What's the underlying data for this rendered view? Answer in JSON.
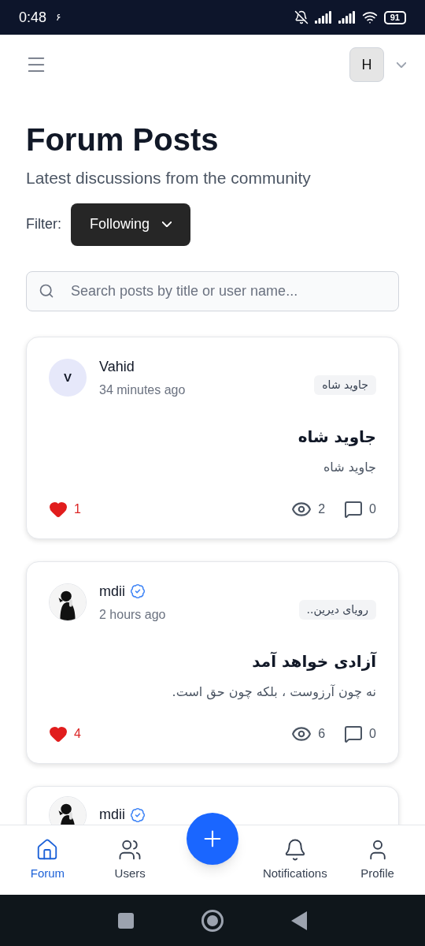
{
  "status_bar": {
    "time": "0:48",
    "indicator": "۶",
    "battery": "91"
  },
  "header": {
    "account_initial": "H"
  },
  "page": {
    "title": "Forum Posts",
    "subtitle": "Latest discussions from the community"
  },
  "filter": {
    "label": "Filter:",
    "value": "Following"
  },
  "search": {
    "placeholder": "Search posts by title or user name..."
  },
  "posts": [
    {
      "author": "Vahid",
      "avatar": {
        "kind": "initial",
        "initial": "V"
      },
      "verified": false,
      "time": "34 minutes ago",
      "tag": "جاوید شاه",
      "title": "جاوید شاه",
      "body": "جاوید شاه",
      "likes": "1",
      "liked": true,
      "views": "2",
      "comments": "0"
    },
    {
      "author": "mdii",
      "verified": true,
      "time": "2 hours ago",
      "tag": "رویای دیرین..",
      "title": "آزادی خواهد آمد",
      "body": "نه چون آرزوست ، بلکه چون حق است.",
      "likes": "4",
      "liked": true,
      "views": "6",
      "comments": "0"
    },
    {
      "author": "mdii",
      "verified": true
    }
  ],
  "bottom_nav": [
    {
      "kind": "tab",
      "label": "Forum",
      "selected": true
    },
    {
      "kind": "tab",
      "label": "Users",
      "selected": false
    },
    {
      "kind": "fab"
    },
    {
      "kind": "tab",
      "label": "Notifications",
      "selected": false
    },
    {
      "kind": "tab",
      "label": "Profile",
      "selected": false
    }
  ]
}
